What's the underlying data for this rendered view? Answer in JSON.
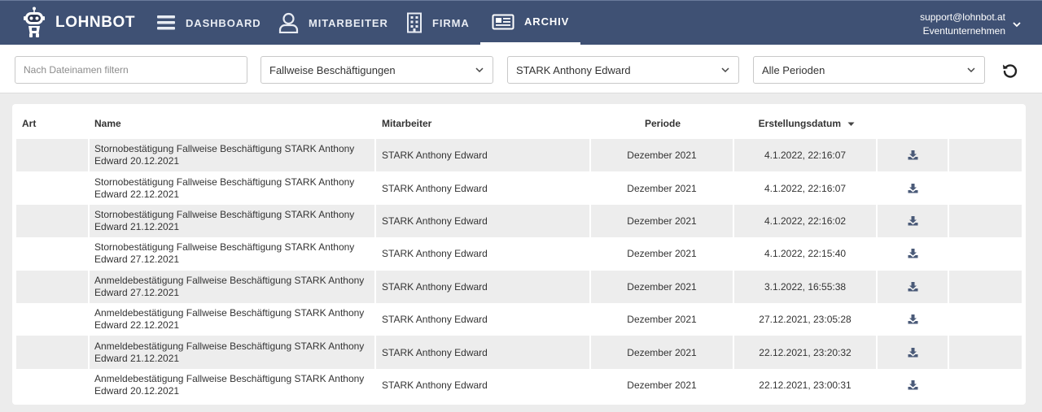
{
  "navbar": {
    "brand": "LOHNBOT",
    "items": [
      {
        "label": "DASHBOARD",
        "icon": "menu-icon"
      },
      {
        "label": "MITARBEITER",
        "icon": "user-icon"
      },
      {
        "label": "FIRMA",
        "icon": "building-icon"
      },
      {
        "label": "ARCHIV",
        "icon": "newspaper-icon",
        "active": true
      }
    ],
    "user": {
      "email": "support@lohnbot.at",
      "company": "Eventunternehmen"
    }
  },
  "filters": {
    "filename_placeholder": "Nach Dateinamen filtern",
    "type_selected": "Fallweise Beschäftigungen",
    "employee_selected": "STARK Anthony Edward",
    "period_selected": "Alle Perioden"
  },
  "table": {
    "headers": {
      "art": "Art",
      "name": "Name",
      "mitarbeiter": "Mitarbeiter",
      "periode": "Periode",
      "erstellungsdatum": "Erstellungsdatum"
    },
    "rows": [
      {
        "art": "",
        "name": "Stornobestätigung Fallweise Beschäftigung STARK Anthony Edward 20.12.2021",
        "mitarbeiter": "STARK Anthony Edward",
        "periode": "Dezember 2021",
        "datum": "4.1.2022, 22:16:07"
      },
      {
        "art": "",
        "name": "Stornobestätigung Fallweise Beschäftigung STARK Anthony Edward 22.12.2021",
        "mitarbeiter": "STARK Anthony Edward",
        "periode": "Dezember 2021",
        "datum": "4.1.2022, 22:16:07"
      },
      {
        "art": "",
        "name": "Stornobestätigung Fallweise Beschäftigung STARK Anthony Edward 21.12.2021",
        "mitarbeiter": "STARK Anthony Edward",
        "periode": "Dezember 2021",
        "datum": "4.1.2022, 22:16:02"
      },
      {
        "art": "",
        "name": "Stornobestätigung Fallweise Beschäftigung STARK Anthony Edward 27.12.2021",
        "mitarbeiter": "STARK Anthony Edward",
        "periode": "Dezember 2021",
        "datum": "4.1.2022, 22:15:40"
      },
      {
        "art": "",
        "name": "Anmeldebestätigung Fallweise Beschäftigung STARK Anthony Edward 27.12.2021",
        "mitarbeiter": "STARK Anthony Edward",
        "periode": "Dezember 2021",
        "datum": "3.1.2022, 16:55:38"
      },
      {
        "art": "",
        "name": "Anmeldebestätigung Fallweise Beschäftigung STARK Anthony Edward 22.12.2021",
        "mitarbeiter": "STARK Anthony Edward",
        "periode": "Dezember 2021",
        "datum": "27.12.2021, 23:05:28"
      },
      {
        "art": "",
        "name": "Anmeldebestätigung Fallweise Beschäftigung STARK Anthony Edward 21.12.2021",
        "mitarbeiter": "STARK Anthony Edward",
        "periode": "Dezember 2021",
        "datum": "22.12.2021, 23:20:32"
      },
      {
        "art": "",
        "name": "Anmeldebestätigung Fallweise Beschäftigung STARK Anthony Edward 20.12.2021",
        "mitarbeiter": "STARK Anthony Edward",
        "periode": "Dezember 2021",
        "datum": "22.12.2021, 23:00:31"
      }
    ]
  },
  "colors": {
    "navbar": "#3f5174",
    "row_alt": "#ededed",
    "icon": "#4a5a78"
  }
}
